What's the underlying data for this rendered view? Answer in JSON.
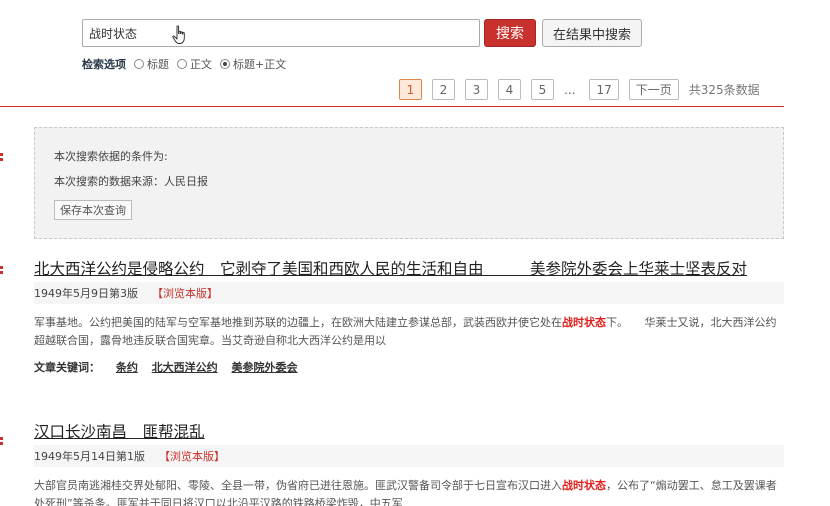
{
  "search": {
    "value": "战时状态",
    "button_label": "搜索",
    "in_results_label": "在结果中搜索"
  },
  "options": {
    "label": "检索选项",
    "choices": [
      "标题",
      "正文",
      "标题+正文"
    ],
    "selected": "标题+正文"
  },
  "pagination": {
    "pages": [
      "1",
      "2",
      "3",
      "4",
      "5"
    ],
    "current": "1",
    "ellipsis": "...",
    "last": "17",
    "next": "下一页",
    "total": "共325条数据"
  },
  "criteria": {
    "line1": "本次搜索依据的条件为:",
    "line2": "本次搜索的数据来源：人民日报",
    "save_label": "保存本次查询"
  },
  "results": [
    {
      "title": "北大西洋公约是侵略公约　它剥夺了美国和西欧人民的生活和自由　　　美参院外委会上华莱士坚表反对",
      "date": "1949年5月9日第3版",
      "browse": "【浏览本版】",
      "body_before": "军事基地。公约把美国的陆军与空军基地推到苏联的边疆上，在欧洲大陆建立参谋总部，武装西欧并使它处在",
      "highlight": "战时状态",
      "body_after": "下。　　华莱士又说，北大西洋公约超越联合国，露骨地违反联合国宪章。当艾奇逊自称北大西洋公约是用以",
      "keywords_label": "文章关键词：",
      "keywords": [
        "条约",
        "北大西洋公约",
        "美参院外委会"
      ]
    },
    {
      "title": "汉口长沙南昌　匪帮混乱",
      "date": "1949年5月14日第1版",
      "browse": "【浏览本版】",
      "body_before": "大部官员南逃湘桂交界处郁阳、零陵、全县一带，伪省府已迸往恩施。匪武汉警备司令部于七日宣布汉口进入",
      "highlight": "战时状态",
      "body_after": "，公布了“煽动罢工、怠工及罢课者处死刑”等杀条。匪军并于同日将汉口以北沿平汉路的铁路桥梁炸毁，中五军"
    }
  ],
  "colors": {
    "accent": "#c8312d",
    "highlight": "#e3201b",
    "active_page_bg": "#fde8d9"
  }
}
